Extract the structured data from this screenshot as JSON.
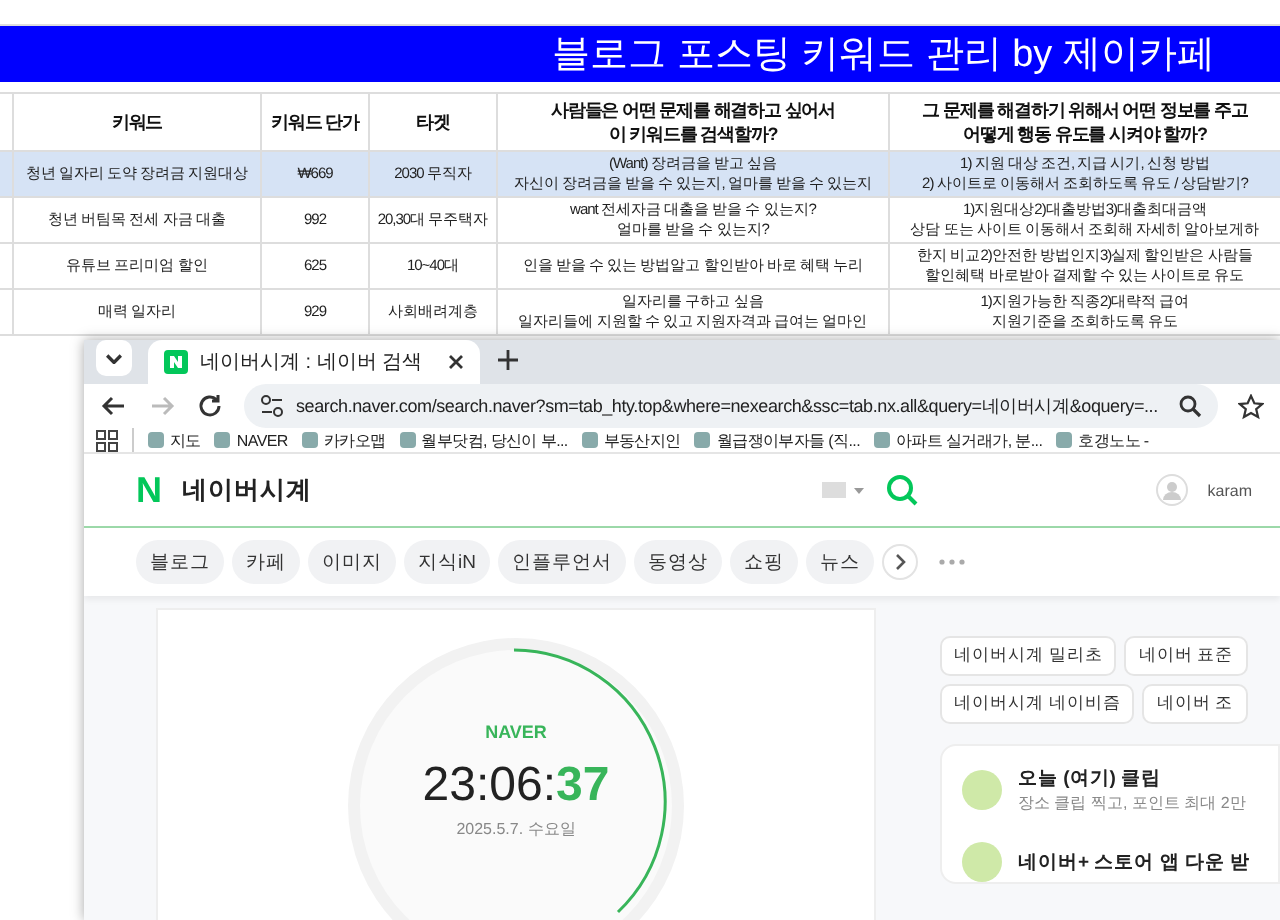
{
  "sheet": {
    "title": "블로그 포스팅 키워드 관리 by 제이카페",
    "columns": [
      "키워드",
      "키워드 단가",
      "타겟",
      "사람들은 어떤 문제를 해결하고 싶어서\n이 키워드를 검색할까?",
      "그 문제를 해결하기 위해서 어떤 정보를 주고\n어떻게 행동 유도를 시켜야 할까?"
    ],
    "rows": [
      {
        "selected": true,
        "cells": [
          [
            "청년 일자리 도약 장려금 지원대상"
          ],
          [
            "₩669"
          ],
          [
            "2030 무직자"
          ],
          [
            "(Want) 장려금을 받고 싶음",
            "자신이 장려금을 받을 수 있는지, 얼마를 받을 수 있는지"
          ],
          [
            "1) 지원 대상 조건, 지급 시기, 신청 방법",
            "2) 사이트로 이동해서 조회하도록 유도 / 상담받기?"
          ]
        ]
      },
      {
        "selected": false,
        "cells": [
          [
            "청년 버팀목 전세 자금 대출"
          ],
          [
            "992"
          ],
          [
            "20,30대 무주택자"
          ],
          [
            "want 전세자금 대출을 받을 수 있는지?",
            "얼마를 받을 수 있는지?"
          ],
          [
            "1)지원대상2)대출방법3)대출최대금액",
            "상담 또는 사이트 이동해서 조회해 자세히 알아보게하"
          ]
        ]
      },
      {
        "selected": false,
        "cells": [
          [
            "유튜브 프리미엄 할인"
          ],
          [
            "625"
          ],
          [
            "10~40대"
          ],
          [
            "인을 받을 수 있는 방법알고 할인받아 바로 혜택 누리"
          ],
          [
            "한지 비교2)안전한 방법인지3)실제 할인받은 사람들",
            "할인혜택 바로받아 결제할 수 있는 사이트로 유도"
          ]
        ]
      },
      {
        "selected": false,
        "cells": [
          [
            "매력 일자리"
          ],
          [
            "929"
          ],
          [
            "사회배려계층"
          ],
          [
            "일자리를 구하고 싶음",
            "일자리들에 지원할 수 있고 지원자격과 급여는 얼마인"
          ],
          [
            "1)지원가능한 직종2)대략적 급여",
            "지원기준을 조회하도록 유도"
          ]
        ]
      }
    ]
  },
  "browser": {
    "tabs": [
      {
        "title": "네이버시계 : 네이버 검색",
        "selected": true
      }
    ],
    "forward_disabled": true,
    "url": "search.naver.com/search.naver?sm=tab_hty.top&where=nexearch&ssc=tab.nx.all&query=네이버시계&oquery=...",
    "bookmarks": [
      "지도",
      "NAVER",
      "카카오맵",
      "월부닷컴, 당신이 부...",
      "부동산지인",
      "월급쟁이부자들 (직...",
      "아파트 실거래가, 분...",
      "호갱노노 -"
    ]
  },
  "page": {
    "logo": "N",
    "query": "네이버시계",
    "user": "karam",
    "tabs": [
      "블로그",
      "카페",
      "이미지",
      "지식iN",
      "인플루언서",
      "동영상",
      "쇼핑",
      "뉴스"
    ],
    "clock": {
      "brand": "NAVER",
      "time": "23:06:",
      "seconds": "37",
      "date": "2025.5.7. 수요일"
    },
    "related": [
      "네이버시계 밀리초",
      "네이버 표준",
      "네이버시계 네이비즘",
      "네이버 조"
    ],
    "feed": [
      {
        "title": "오늘 (여기) 클립",
        "subtitle": "장소 클립 찍고, 포인트 최대 2만"
      },
      {
        "title": "네이버+ 스토어 앱 다운 받"
      }
    ]
  }
}
